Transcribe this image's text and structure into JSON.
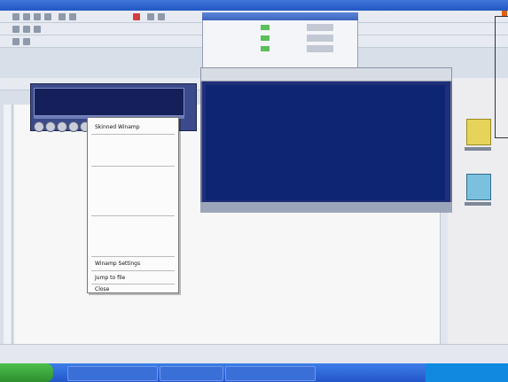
{
  "context_menu": {
    "items": [
      {
        "label": "Skinned Winamp"
      },
      {
        "label": ""
      },
      {
        "label": ""
      },
      {
        "label": ""
      },
      {
        "label": ""
      },
      {
        "label": ""
      },
      {
        "label": ""
      },
      {
        "label": ""
      },
      {
        "label": ""
      },
      {
        "label": ""
      },
      {
        "label": ""
      },
      {
        "label": ""
      },
      {
        "label": ""
      },
      {
        "label": "Winamp Settings"
      },
      {
        "label": "Jump to file"
      },
      {
        "label": "Close"
      }
    ]
  },
  "colors": {
    "taskbar": "#2456c9",
    "winamp_display": "#15205a",
    "playlist_body": "#0e2573",
    "start_button": "#2e8f2e"
  },
  "icons": {
    "folder": "folder-icon",
    "search": "search-icon"
  }
}
